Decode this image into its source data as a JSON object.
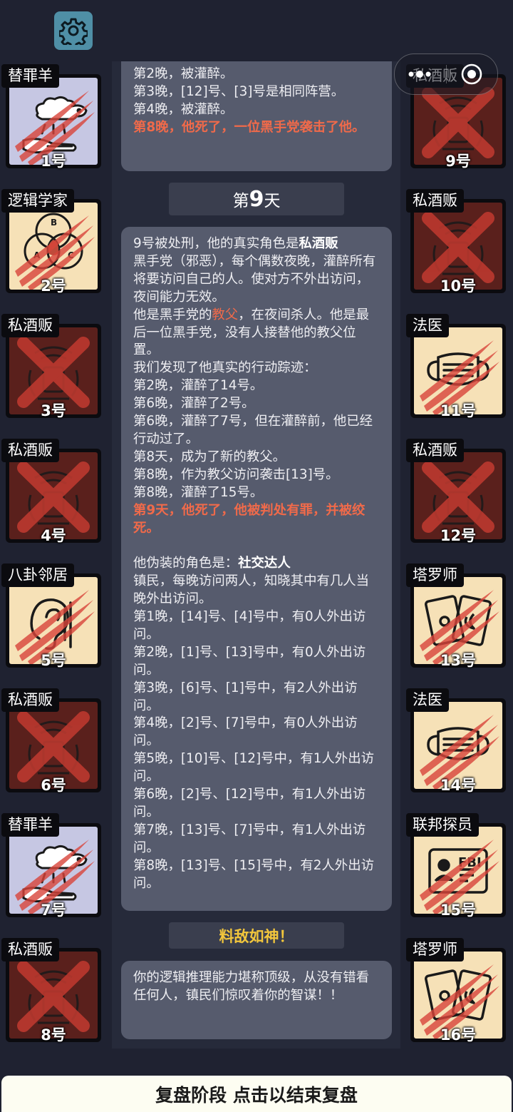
{
  "top_bar": {
    "settings_icon": "gear-icon",
    "menu_icon": "more-dots-icon",
    "close_icon": "target-circle-icon"
  },
  "colors": {
    "background": "#1f2231",
    "bubble": "#565b6d",
    "highlight_red": "#f06a4a",
    "highlight_yellow": "#f2c63c"
  },
  "players_left": [
    {
      "role": "替罪羊",
      "number": "1号",
      "art": "sheep-icon",
      "bg": "#c6c7e3",
      "dead": false
    },
    {
      "role": "逻辑学家",
      "number": "2号",
      "art": "venn-diagram-icon",
      "bg": "#f6e1b7",
      "dead": false
    },
    {
      "role": "私酒贩",
      "number": "3号",
      "art": "bootlegger-icon",
      "bg": "#5a201c",
      "dead": true
    },
    {
      "role": "私酒贩",
      "number": "4号",
      "art": "bootlegger-icon",
      "bg": "#5a201c",
      "dead": true
    },
    {
      "role": "八卦邻居",
      "number": "5号",
      "art": "ear-icon",
      "bg": "#f6e1b7",
      "dead": false
    },
    {
      "role": "私酒贩",
      "number": "6号",
      "art": "bootlegger-icon",
      "bg": "#5a201c",
      "dead": true
    },
    {
      "role": "替罪羊",
      "number": "7号",
      "art": "sheep-icon",
      "bg": "#c6c7e3",
      "dead": false
    },
    {
      "role": "私酒贩",
      "number": "8号",
      "art": "bootlegger-icon",
      "bg": "#5a201c",
      "dead": true
    }
  ],
  "players_right": [
    {
      "role": "私酒贩",
      "number": "9号",
      "art": "bootlegger-icon",
      "bg": "#5a201c",
      "dead": true
    },
    {
      "role": "私酒贩",
      "number": "10号",
      "art": "bootlegger-icon",
      "bg": "#5a201c",
      "dead": true
    },
    {
      "role": "法医",
      "number": "11号",
      "art": "mask-icon",
      "bg": "#f6e1b7",
      "dead": false
    },
    {
      "role": "私酒贩",
      "number": "12号",
      "art": "bootlegger-icon",
      "bg": "#5a201c",
      "dead": true
    },
    {
      "role": "塔罗师",
      "number": "13号",
      "art": "tarot-cards-icon",
      "bg": "#f6e1b7",
      "dead": false
    },
    {
      "role": "法医",
      "number": "14号",
      "art": "mask-icon",
      "bg": "#f6e1b7",
      "dead": false
    },
    {
      "role": "联邦探员",
      "number": "15号",
      "art": "fbi-badge-icon",
      "bg": "#f6e1b7",
      "dead": false
    },
    {
      "role": "塔罗师",
      "number": "16号",
      "art": "tarot-cards-icon",
      "bg": "#f6e1b7",
      "dead": false
    }
  ],
  "log": {
    "prev_lines": [
      "第2晚，被灌醉。",
      "第3晚，[12]号、[3]号是相同阵营。",
      "第4晚，被灌醉。"
    ],
    "prev_death": "第8晚，他死了，一位黑手党袭击了他。",
    "day_prefix": "第",
    "day_number": "9",
    "day_suffix": "天",
    "exec_prefix": "9号被处刑，他的真实角色是",
    "exec_role": "私酒贩",
    "role_desc": "黑手党（邪恶），每个偶数夜晚，灌醉所有将要访问自己的人。使对方不外出访问，夜间能力无效。",
    "godfather_prefix": "他是黑手党的",
    "godfather_word": "教父",
    "godfather_suffix": "，在夜间杀人。他是最后一位黑手党，没有人接替他的教父位置。",
    "trace_lines": [
      "我们发现了他真实的行动踪迹：",
      "第2晚，灌醉了14号。",
      "第6晚，灌醉了2号。",
      "第6晚，灌醉了7号，但在灌醉前，他已经行动过了。",
      "第8天，成为了新的教父。",
      "第8晚，作为教父访问袭击[13]号。",
      "第8晚，灌醉了15号。"
    ],
    "verdict": "第9天，他死了，他被判处有罪，并被绞死。",
    "disguise_prefix": "他伪装的角色是：",
    "disguise_role": "社交达人",
    "disguise_lines": [
      "镇民，每晚访问两人，知晓其中有几人当晚外出访问。",
      "第1晚，[14]号、[4]号中，有0人外出访问。",
      "第2晚，[1]号、[13]号中，有0人外出访问。",
      "第3晚，[6]号、[1]号中，有2人外出访问。",
      "第4晚，[2]号、[7]号中，有0人外出访问。",
      "第5晚，[10]号、[12]号中，有1人外出访问。",
      "第6晚，[2]号、[12]号中，有1人外出访问。",
      "第7晚，[13]号、[7]号中，有1人外出访问。",
      "第8晚，[13]号、[15]号中，有2人外出访问。"
    ],
    "result_title": "料敌如神！",
    "result_text": "你的逻辑推理能力堪称顶级，从没有错看任何人，镇民们惊叹着你的智谋！！"
  },
  "bottom_bar": {
    "label": "复盘阶段 点击以结束复盘"
  }
}
